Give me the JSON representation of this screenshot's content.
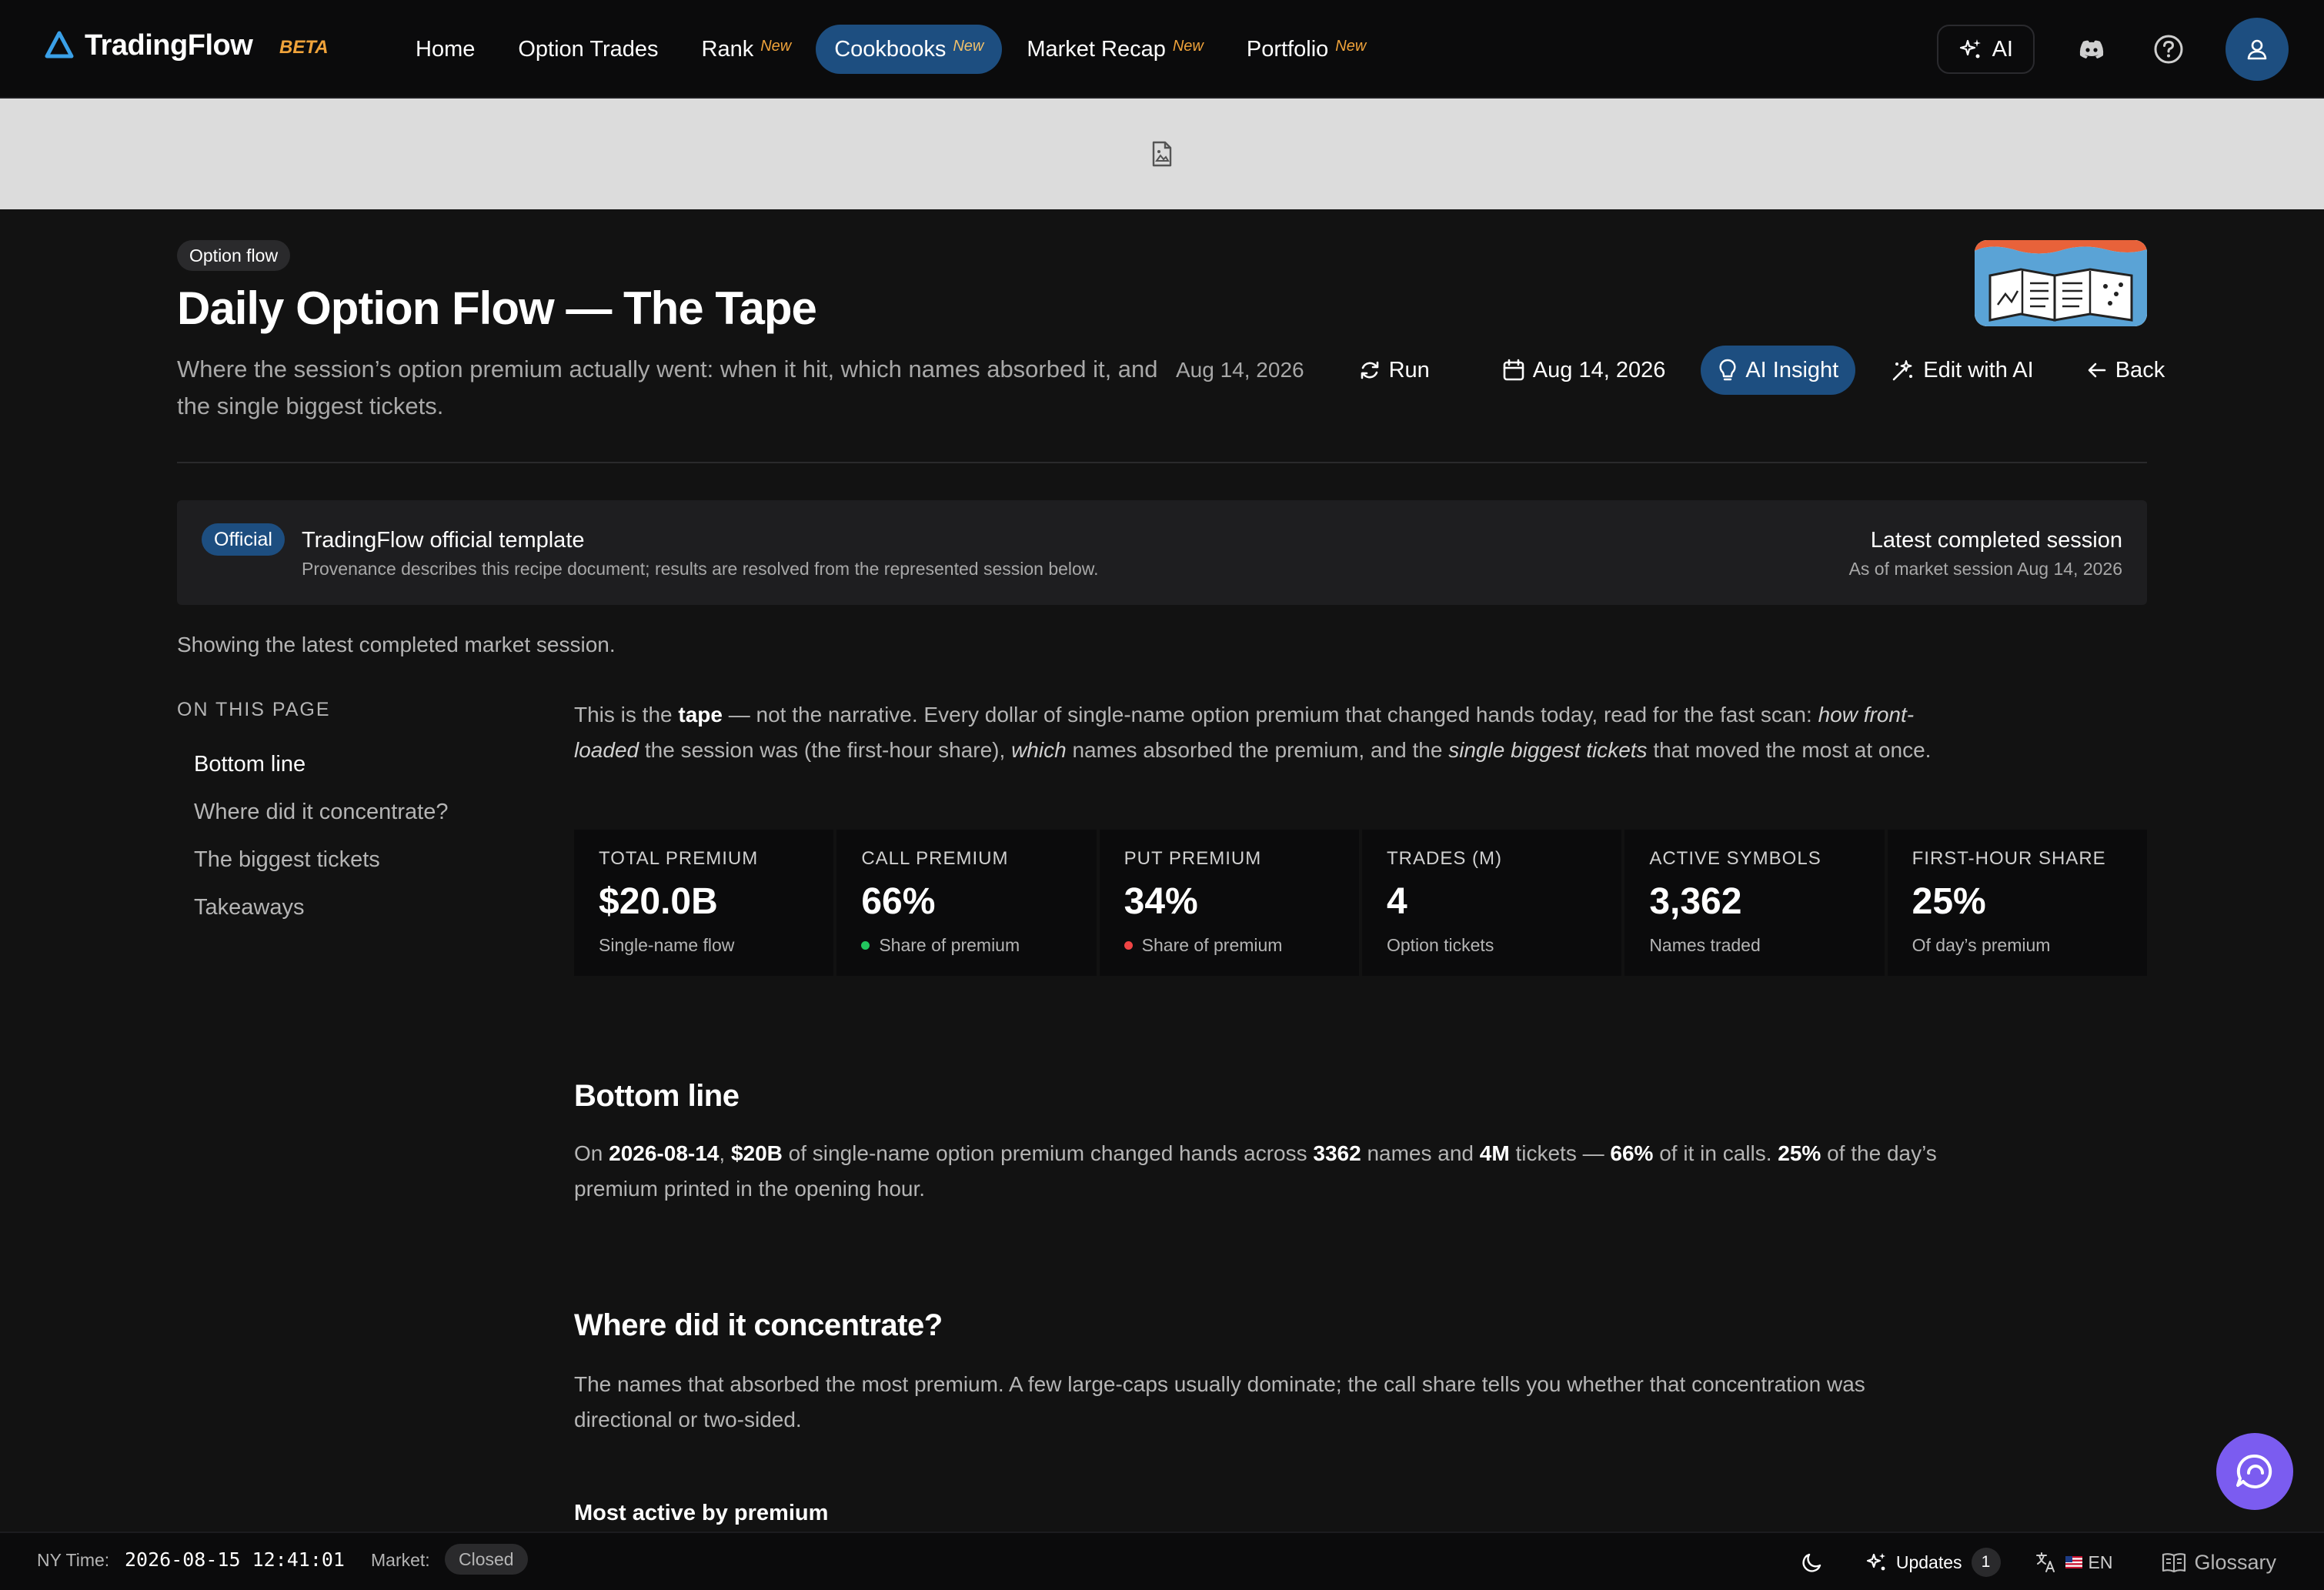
{
  "header": {
    "brand_name": "TradingFlow",
    "beta_label": "BETA",
    "nav": [
      {
        "label": "Home",
        "badge": ""
      },
      {
        "label": "Option Trades",
        "badge": ""
      },
      {
        "label": "Rank",
        "badge": "New"
      },
      {
        "label": "Cookbooks",
        "badge": "New",
        "active": true
      },
      {
        "label": "Market Recap",
        "badge": "New"
      },
      {
        "label": "Portfolio",
        "badge": "New"
      }
    ],
    "ai_label": "AI",
    "icons": [
      "sparkles-icon",
      "discord-icon",
      "help-icon",
      "user-icon"
    ]
  },
  "banner": {
    "icon": "broken-image-icon"
  },
  "recipe": {
    "category_chip": "Option flow",
    "title": "Daily Option Flow — The Tape",
    "subtitle": "Where the session’s option premium actually went: when it hit, which names absorbed it, and the single biggest tickets.",
    "date_text": "Aug 14, 2026",
    "actions": {
      "run": "Run",
      "date_picker": "Aug 14, 2026",
      "ai_insight": "AI Insight",
      "edit_with_ai": "Edit with AI",
      "back": "Back"
    }
  },
  "official": {
    "badge": "Official",
    "title": "TradingFlow official template",
    "description": "Provenance describes this recipe document; results are resolved from the represented session below.",
    "right_title": "Latest completed session",
    "right_subtitle": "As of market session Aug 14, 2026"
  },
  "showing_text": "Showing the latest completed market session.",
  "toc": {
    "title": "ON THIS PAGE",
    "items": [
      "Bottom line",
      "Where did it concentrate?",
      "The biggest tickets",
      "Takeaways"
    ]
  },
  "intro": {
    "p1": "This is the ",
    "b1": "tape",
    "p2": " — not the narrative. Every dollar of single-name option premium that changed hands today, read for the fast scan: ",
    "i1": "how front-loaded",
    "p3": " the session was (the first-hour share), ",
    "i2": "which",
    "p4": " names absorbed the premium, and the ",
    "i3": "single biggest tickets",
    "p5": " that moved the most at once."
  },
  "stats": [
    {
      "label": "TOTAL PREMIUM",
      "value": "$20.0B",
      "sub": "Single-name flow",
      "dot": ""
    },
    {
      "label": "CALL PREMIUM",
      "value": "66%",
      "sub": "Share of premium",
      "dot": "#22c55e"
    },
    {
      "label": "PUT PREMIUM",
      "value": "34%",
      "sub": "Share of premium",
      "dot": "#ef4444"
    },
    {
      "label": "TRADES (M)",
      "value": "4",
      "sub": "Option tickets",
      "dot": ""
    },
    {
      "label": "ACTIVE SYMBOLS",
      "value": "3,362",
      "sub": "Names traded",
      "dot": ""
    },
    {
      "label": "FIRST-HOUR SHARE",
      "value": "25%",
      "sub": "Of day’s premium",
      "dot": ""
    }
  ],
  "bottom_line": {
    "heading": "Bottom line",
    "t1": "On ",
    "date": "2026-08-14",
    "t2": ", ",
    "premium": "$20B",
    "t3": " of single-name option premium changed hands across ",
    "names": "3362",
    "t4": " names and ",
    "tickets": "4M",
    "t5": " tickets — ",
    "calls": "66%",
    "t6": " of it in calls. ",
    "first_hour": "25%",
    "t7": " of the day’s premium printed in the opening hour."
  },
  "concentration": {
    "heading": "Where did it concentrate?",
    "text": "The names that absorbed the most premium. A few large-caps usually dominate; the call share tells you whether that concentration was directional or two-sided.",
    "subheading": "Most active by premium"
  },
  "footer": {
    "ny_label": "NY Time:",
    "ny_time": "2026-08-15 12:41:01",
    "market_label": "Market:",
    "market_status": "Closed",
    "updates_label": "Updates",
    "updates_count": "1",
    "lang_label": "EN",
    "glossary_label": "Glossary"
  },
  "colors": {
    "accent": "#1d4e80",
    "new_badge": "#f0a33a",
    "chat_fab": "#7b5cf0"
  }
}
